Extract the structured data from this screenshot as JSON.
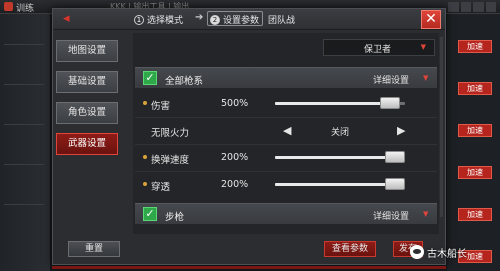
{
  "background": {
    "title": "训练",
    "top_text": "KKK | 输出工具 | 输出",
    "chip_label": "加速",
    "chip_count": 6
  },
  "dialog": {
    "steps": [
      {
        "num": "1",
        "label": "选择模式"
      },
      {
        "num": "2",
        "label": "设置参数"
      }
    ],
    "mode": "团队战",
    "close": "✕",
    "back": "◂"
  },
  "tabs": [
    {
      "label": "地图设置"
    },
    {
      "label": "基础设置"
    },
    {
      "label": "角色设置"
    },
    {
      "label": "武器设置",
      "active": true
    }
  ],
  "preset": {
    "value": "保卫者"
  },
  "sections": [
    {
      "label": "全部枪系",
      "detail": "详细设置",
      "checked": true,
      "rows": [
        {
          "name": "伤害",
          "value": "500%",
          "slider": 0.95
        },
        {
          "name": "无限火力",
          "toggle": "关闭"
        },
        {
          "name": "换弹速度",
          "value": "200%",
          "slider": 1.0
        },
        {
          "name": "穿透",
          "value": "200%",
          "slider": 1.0
        }
      ]
    },
    {
      "label": "步枪",
      "detail": "详细设置",
      "checked": true,
      "rows": []
    }
  ],
  "footer": {
    "reset": "重置",
    "view": "查看参数",
    "start": "发布"
  },
  "watermark": "古木船长",
  "colors": {
    "accent_red": "#e0443a",
    "check_green": "#2fa84a",
    "panel_bg": "#232528"
  }
}
